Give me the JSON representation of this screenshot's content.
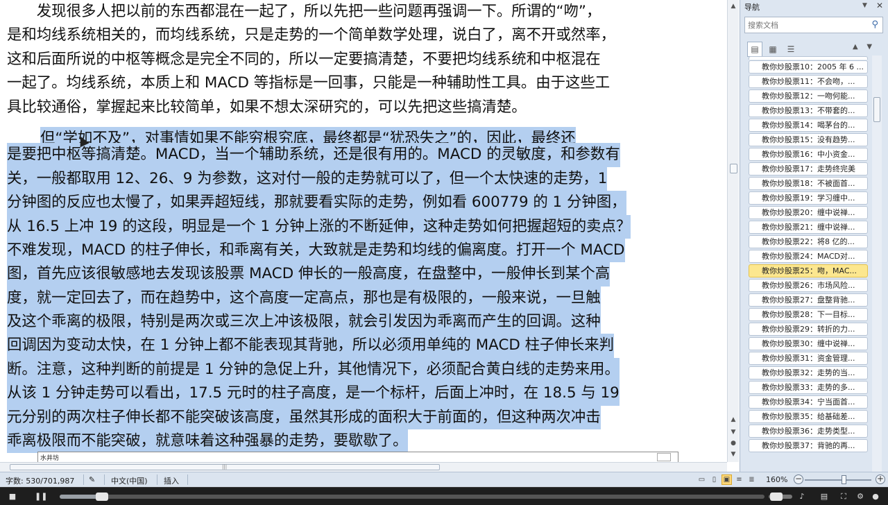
{
  "document": {
    "lines_normal": [
      "　　发现很多人把以前的东西都混在一起了，所以先把一些问题再强调一下。所谓的“吻”，",
      "是和均线系统相关的，而均线系统，只是走势的一个简单数学处理，说白了，离不开或然率，",
      "这和后面所说的中枢等概念是完全不同的，所以一定要搞清楚，不要把均线系统和中枢混在",
      "一起了。均线系统，本质上和 MACD 等指标是一回事，只能是一种辅助性工具。由于这些工",
      "具比较通俗，掌握起来比较简单，如果不想太深研究的，可以先把这些搞清楚。"
    ],
    "lines_selected": [
      "但“学如不及”，对事情如果不能穷根究底，最终都是“犹恐失之”的，因此，最终还",
      "是要把中枢等搞清楚。MACD，当一个辅助系统，还是很有用的。MACD 的灵敏度，和参数有",
      "关，一般都取用 12、26、9 为参数，这对付一般的走势就可以了，但一个太快速的走势，1",
      "分钟图的反应也太慢了，如果弄超短线，那就要看实际的走势，例如看 600779 的 1 分钟图，",
      "从 16.5 上冲 19 的这段，明显是一个 1 分钟上涨的不断延伸，这种走势如何把握超短的卖点？",
      "不难发现，MACD 的柱子伸长，和乖离有关，大致就是走势和均线的偏离度。打开一个 MACD",
      "图，首先应该很敏感地去发现该股票 MACD 伸长的一般高度，在盘整中，一般伸长到某个高",
      "度，就一定回去了，而在趋势中，这个高度一定高点，那也是有极限的，一般来说，一旦触",
      "及这个乖离的极限，特别是两次或三次上冲该极限，就会引发因为乖离而产生的回调。这种",
      "回调因为变动太快，在 1 分钟上都不能表现其背驰，所以必须用单纯的 MACD 柱子伸长来判",
      "断。注意，这种判断的前提是 1 分钟的急促上升，其他情况下，必须配合黄白线的走势来用。",
      "从该 1 分钟走势可以看出，17.5 元时的柱子高度，是一个标杆，后面上冲时，在 18.5 与 19",
      "元分别的两次柱子伸长都不能突破该高度，虽然其形成的面积大于前面的，但这种两次冲击",
      "乖离极限而不能突破，就意味着这种强暴的走势，要歇歇了。"
    ],
    "embed_label": "水井坊"
  },
  "nav": {
    "title": "导航",
    "search_placeholder": "搜索文档",
    "items": [
      "教你炒股票10：2005 年 6 ...",
      "教你炒股票11：不会吻，...",
      "教你炒股票12：一吻何能...",
      "教你炒股票13：不带套的...",
      "教你炒股票14：喝茅台的...",
      "教你炒股票15：没有趋势...",
      "教你炒股票16：中小资金...",
      "教你炒股票17：走势终完美",
      "教你炒股票18：不被面首...",
      "教你炒股票19：学习缠中...",
      "教你炒股票20：缠中说禅...",
      "教你炒股票21：缠中说禅...",
      "教你炒股票22：将8 亿的...",
      "教你炒股票24：MACD对...",
      "教你炒股票25：吻，MAC...",
      "教你炒股票26：市场风险...",
      "教你炒股票27：盘整背驰...",
      "教你炒股票28：下一目标...",
      "教你炒股票29：转折的力...",
      "教你炒股票30：缠中说禅...",
      "教你炒股票31：资金管理...",
      "教你炒股票32：走势的当...",
      "教你炒股票33：走势的多...",
      "教你炒股票34：宁当面首...",
      "教你炒股票35：给基础差...",
      "教你炒股票36：走势类型...",
      "教你炒股票37：背驰的再..."
    ],
    "active_index": 14
  },
  "status": {
    "word_count": "字数: 530/701,987",
    "language": "中文(中国)",
    "mode": "插入",
    "zoom": "160%"
  },
  "player": {
    "progress": 0.06,
    "volume": 0.5
  }
}
